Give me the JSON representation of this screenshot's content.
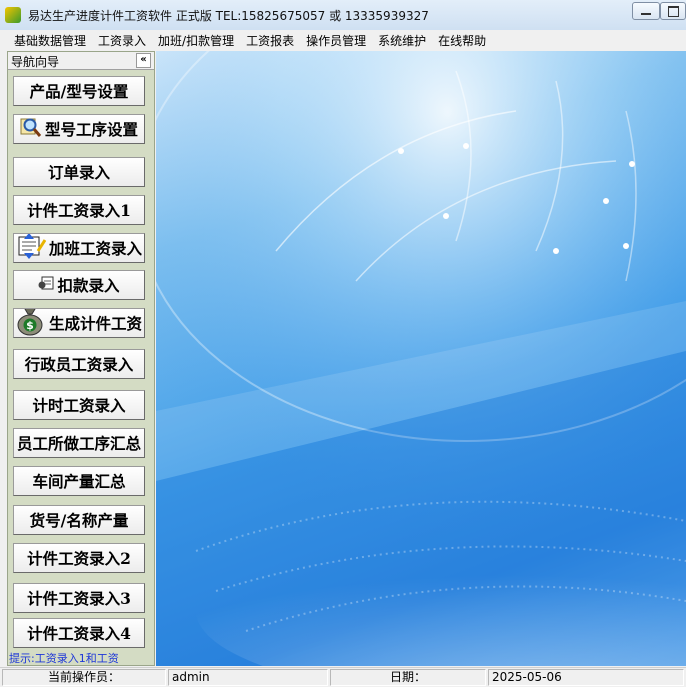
{
  "window": {
    "title": "易达生产进度计件工资软件  正式版  TEL:15825675057 或 13335939327"
  },
  "menu": [
    "基础数据管理",
    "工资录入",
    "加班/扣款管理",
    "工资报表",
    "操作员管理",
    "系统维护",
    "在线帮助"
  ],
  "sidebar": {
    "title": "导航向导",
    "collapse_label": "«",
    "buttons": [
      {
        "label": "产品/型号设置",
        "icon": ""
      },
      {
        "label": "型号工序设置",
        "icon": "magnifier-icon"
      },
      {
        "label": "订单录入",
        "icon": ""
      },
      {
        "label": "计件工资录入1",
        "icon": ""
      },
      {
        "label": "加班工资录入",
        "icon": "overtime-icon"
      },
      {
        "label": "扣款录入",
        "icon": "deduction-icon"
      },
      {
        "label": "生成计件工资",
        "icon": "money-bag-icon"
      },
      {
        "label": "行政员工资录入",
        "icon": ""
      },
      {
        "label": "计时工资录入",
        "icon": ""
      },
      {
        "label": "员工所做工序汇总",
        "icon": ""
      },
      {
        "label": "车间产量汇总",
        "icon": ""
      },
      {
        "label": "货号/名称产量",
        "icon": ""
      },
      {
        "label": "计件工资录入2",
        "icon": ""
      },
      {
        "label": "计件工资录入3",
        "icon": ""
      },
      {
        "label": "计件工资录入4",
        "icon": ""
      }
    ],
    "hint": "提示:工资录入1和工资"
  },
  "status": {
    "operator_label": "当前操作员：",
    "operator_value": "admin",
    "date_label": "日期：",
    "date_value": "2025-05-06"
  },
  "colors": {
    "sidebar_bg": "#d4dcc4",
    "hint_text": "#1d36d8",
    "main_bg_accent": "#2c86e0"
  }
}
